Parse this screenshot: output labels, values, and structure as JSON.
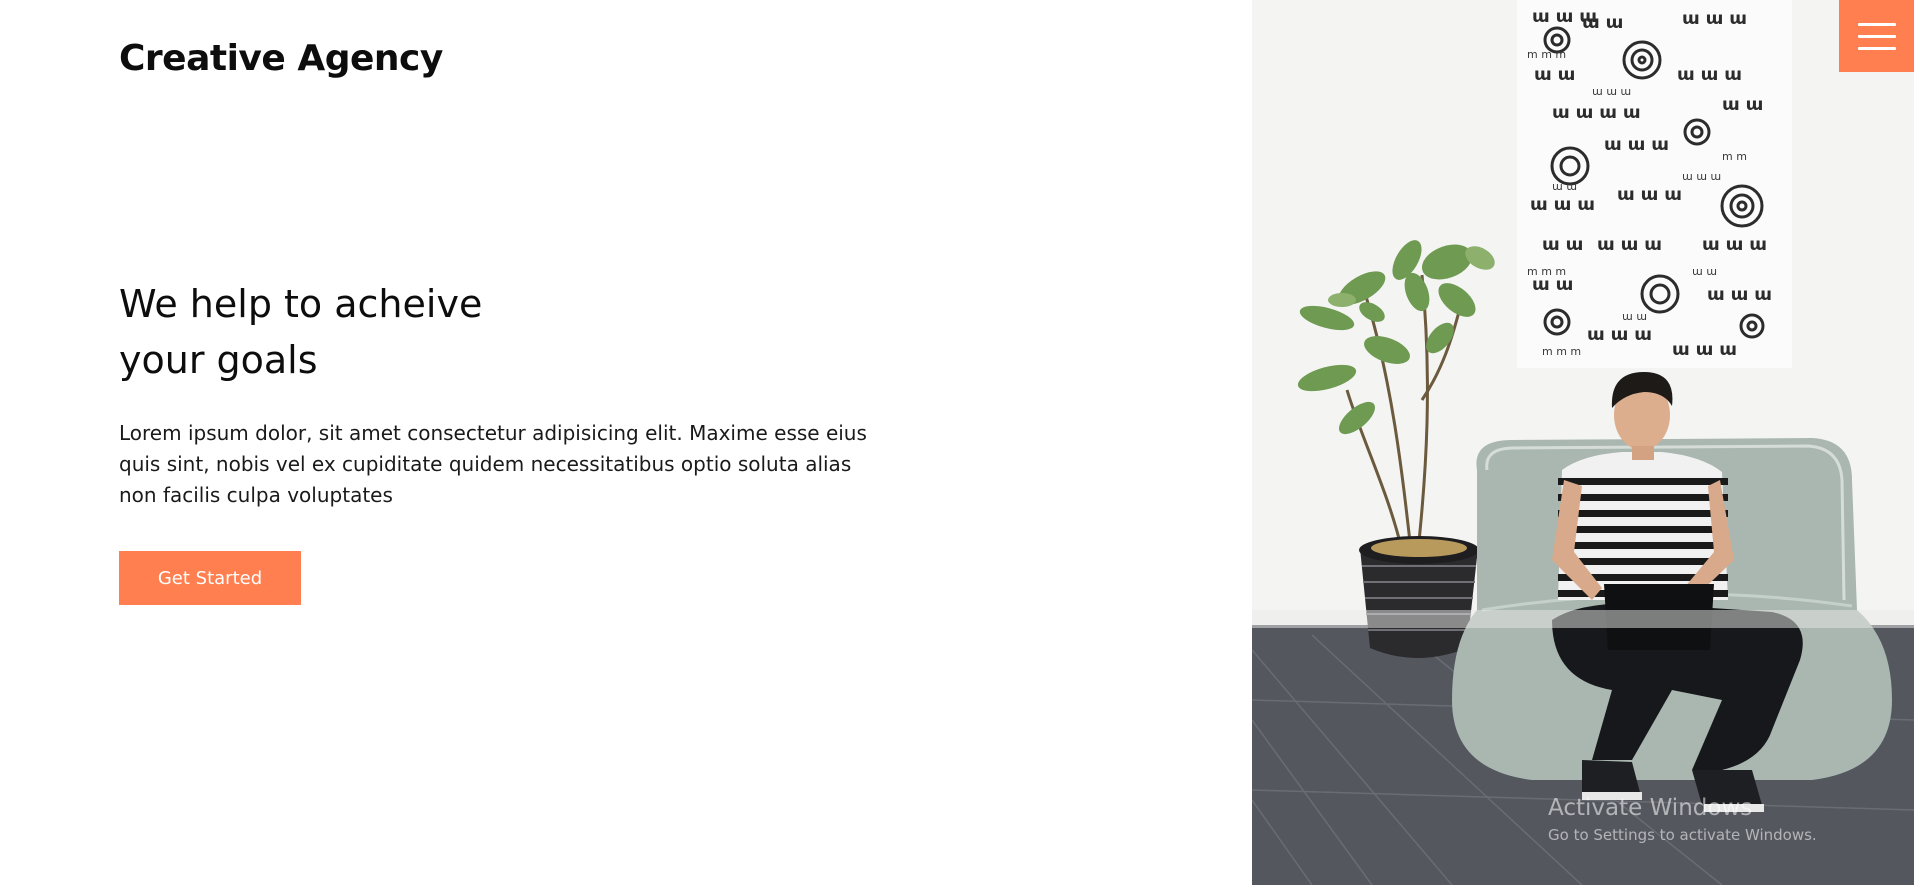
{
  "brand": {
    "name": "Creative Agency"
  },
  "menu": {
    "icon": "hamburger-menu-icon"
  },
  "hero": {
    "heading_line1": "We help to acheive",
    "heading_line2": "your goals",
    "body": "Lorem ipsum dolor, sit amet consectetur adipisicing elit. Maxime esse eius quis sint, nobis vel ex cupiditate quidem necessitatibus optio soluta alias non facilis culpa voluptates",
    "cta_label": "Get Started"
  },
  "watermark": {
    "title": "Activate Windows",
    "subtitle": "Go to Settings to activate Windows."
  },
  "colors": {
    "accent": "#ff7f50",
    "text": "#0d0d0d",
    "background": "#ffffff"
  }
}
